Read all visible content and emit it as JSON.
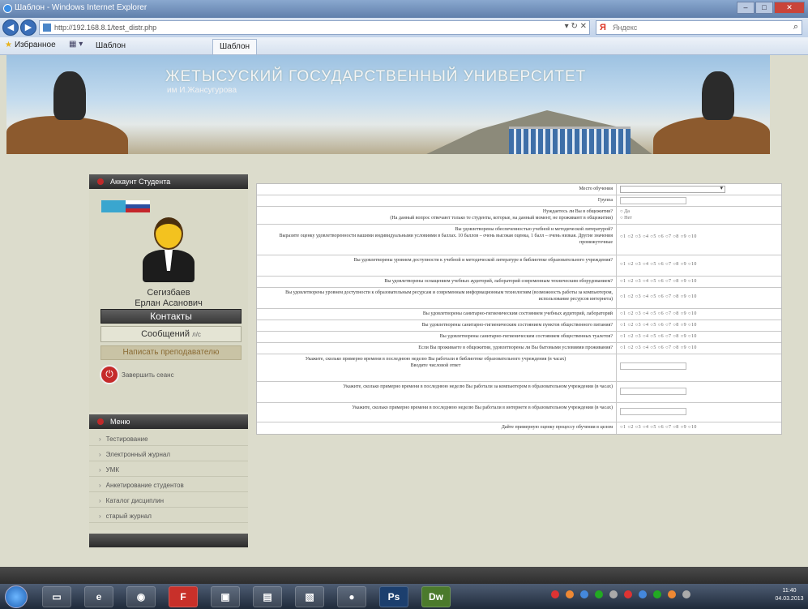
{
  "window": {
    "title": "Шаблон - Windows Internet Explorer"
  },
  "address": {
    "url": "http://192.168.8.1/test_distr.php",
    "search_placeholder": "Яндекс"
  },
  "favorites": {
    "label": "Избранное",
    "tab1": "Шаблон",
    "tab2": "Шаблон"
  },
  "banner": {
    "title": "ЖЕТЫСУСКИЙ ГОСУДАРСТВЕННЫЙ УНИВЕРСИТЕТ",
    "subtitle": "им И.Жансугурова"
  },
  "sidebar": {
    "account_header": "Аккаунт Студента",
    "user_first": "Сегизбаев",
    "user_second": "Ерлан Асанович",
    "contacts": "Контакты",
    "messages": "Сообщений",
    "messages_count": "л/с",
    "write_teacher": "Написать преподавателю",
    "logout": "Завершить сеанс",
    "menu_header": "Меню",
    "menu": [
      "Тестирование",
      "Электронный журнал",
      "УМК",
      "Анкетирование студентов",
      "Каталог дисциплин",
      "старый журнал"
    ]
  },
  "survey": {
    "scale": "○1 ○2 ○3 ○4 ○5 ○6 ○7 ○8 ○9 ○10",
    "rows": [
      {
        "q": "Место обучения",
        "answer": "select"
      },
      {
        "q": "Группа",
        "answer": "text"
      },
      {
        "q": "Нуждаетесь ли Вы в общежитии?",
        "q2": "(На данный вопрос отвечают только те студенты, которые, на данный момент, не проживают в общежитии)",
        "opt1": "○ Да",
        "opt2": "○ Нет"
      },
      {
        "q": "Вы удовлетворены обеспеченностью учебной и методической литературой?",
        "q2": "Выразите оценку удовлетворенности вашими индивидуальными условиями в баллах. 10 баллов – очень высокая оценка, 1 балл – очень низкая. Другие значения промежуточные"
      },
      {
        "q": "Вы удовлетворены уровнем доступности к учебной и методической литературе в библиотеке образовательного учреждения?"
      },
      {
        "q": "Вы удовлетворены оснащением учебных аудиторий, лабораторий современным техническим оборудованием?"
      },
      {
        "q": "Вы удовлетворены уровнем доступности к образовательным ресурсам и современным информационным технологиям (возможность работы за компьютером, использование ресурсов интернета)"
      },
      {
        "q": "Вы удовлетворены санитарно-гигиеническим состоянием учебных аудиторий, лабораторий"
      },
      {
        "q": "Вы удовлетворены санитарно-гигиеническим состоянием пунктов общественного питания?"
      },
      {
        "q": "Вы удовлетворены санитарно-гигиеническим состоянием общественных туалетов?"
      },
      {
        "q": "Если Вы проживаете в общежитии, удовлетворены ли Вы бытовыми условиями проживания?"
      },
      {
        "q": "Укажите, сколько примерно времени в последнюю неделю Вы работали в библиотеке образовательного учреждения (в часах)",
        "q2": "Вводите числовой ответ"
      },
      {
        "q": "Укажите, сколько примерно времени в последнюю неделю Вы работали за компьютером в образовательном учреждении (в часах)"
      },
      {
        "q": "Укажите, сколько примерно времени в последнюю неделю Вы работали в интернете в образовательном учреждении (в часах)"
      },
      {
        "q": "Дайте примерную оценку процессу обучения в целом"
      }
    ]
  },
  "taskbar": {
    "clock_time": "11:40",
    "clock_date": "04.03.2013",
    "apps": [
      "F",
      "Ps",
      "Dw"
    ]
  }
}
